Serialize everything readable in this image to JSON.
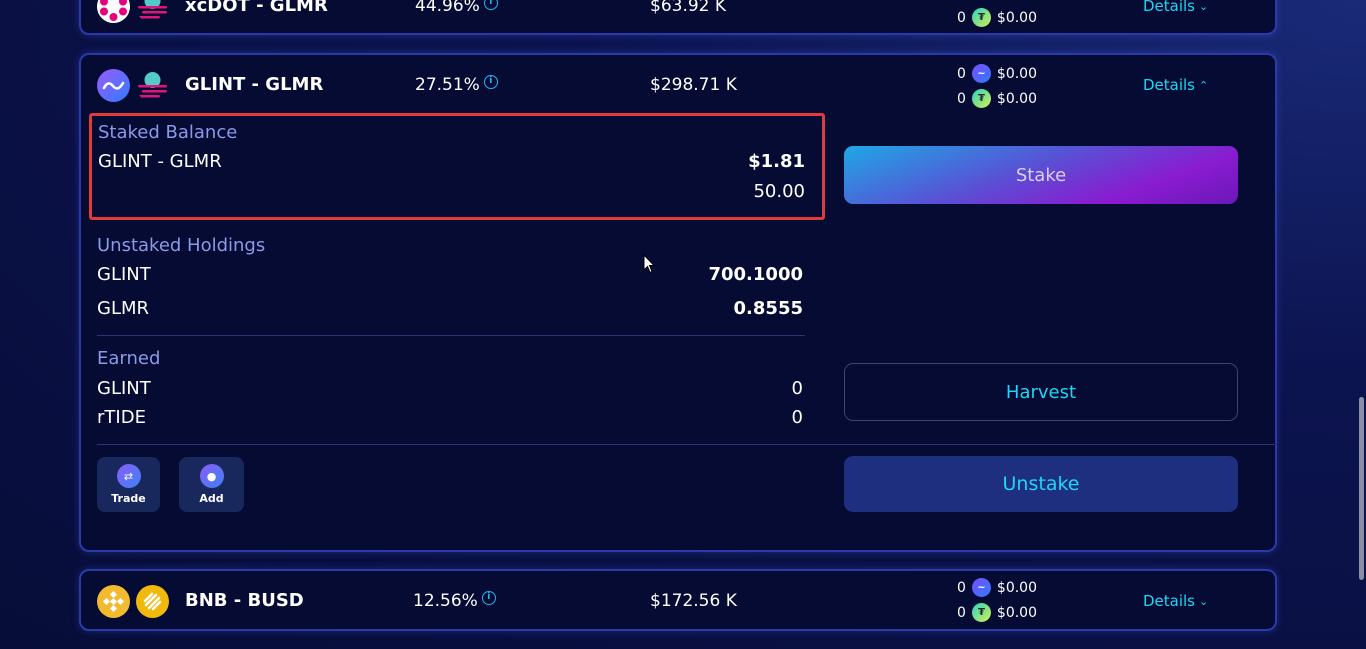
{
  "farms": [
    {
      "pair": "xcDOT - GLMR",
      "apr": "44.96%",
      "liquidity": "$63.92 K",
      "rewards": [
        {
          "amount": "0",
          "token_icon": "tide-icon",
          "usd": "$0.00"
        }
      ],
      "details_label": "Details"
    },
    {
      "pair": "GLINT - GLMR",
      "apr": "27.51%",
      "liquidity": "$298.71 K",
      "rewards": [
        {
          "amount": "0",
          "token_icon": "glint-icon",
          "usd": "$0.00"
        },
        {
          "amount": "0",
          "token_icon": "tide-icon",
          "usd": "$0.00"
        }
      ],
      "details_label": "Details",
      "expanded": {
        "staked_balance": {
          "title": "Staked Balance",
          "pair": "GLINT - GLMR",
          "usd_value": "$1.81",
          "amount": "50.00"
        },
        "unstaked_holdings": {
          "title": "Unstaked Holdings",
          "items": [
            {
              "token": "GLINT",
              "amount": "700.1000"
            },
            {
              "token": "GLMR",
              "amount": "0.8555"
            }
          ]
        },
        "earned": {
          "title": "Earned",
          "items": [
            {
              "token": "GLINT",
              "amount": "0"
            },
            {
              "token": "rTIDE",
              "amount": "0"
            }
          ]
        },
        "actions": {
          "trade_label": "Trade",
          "add_label": "Add",
          "stake_label": "Stake",
          "harvest_label": "Harvest",
          "unstake_label": "Unstake"
        }
      }
    },
    {
      "pair": "BNB - BUSD",
      "apr": "12.56%",
      "liquidity": "$172.56 K",
      "rewards": [
        {
          "amount": "0",
          "token_icon": "glint-icon",
          "usd": "$0.00"
        },
        {
          "amount": "0",
          "token_icon": "tide-icon",
          "usd": "$0.00"
        }
      ],
      "details_label": "Details"
    }
  ],
  "colors": {
    "accent_cyan": "#20d6f4",
    "highlight_red": "#e03a3a",
    "card_border": "#2a3aa8",
    "stake_gradient_start": "#1ea8e6",
    "stake_gradient_end": "#8a1bd0"
  }
}
